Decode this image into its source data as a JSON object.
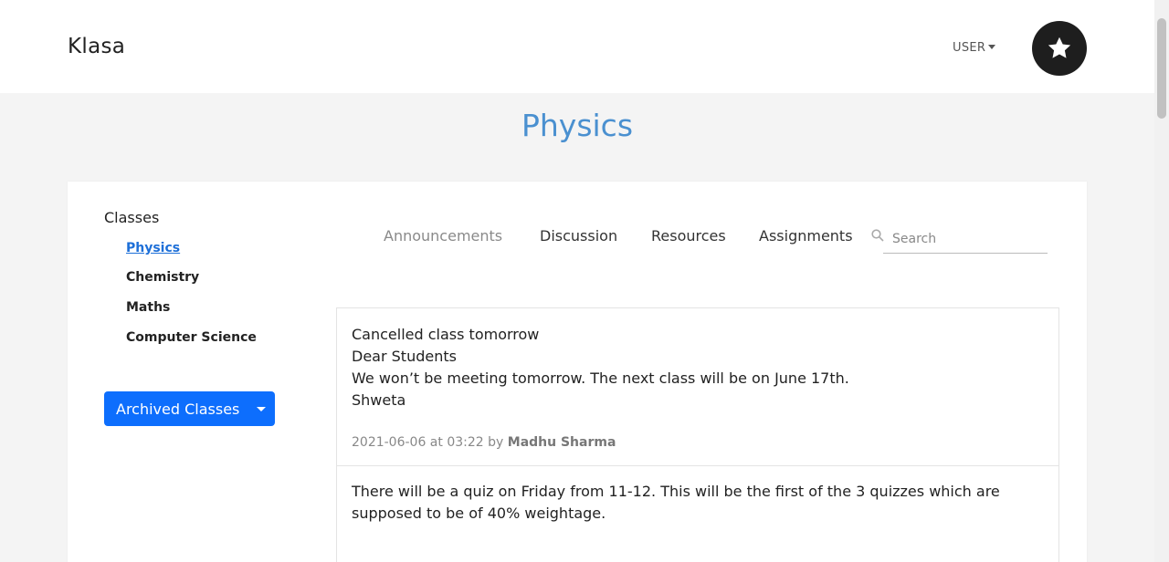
{
  "navbar": {
    "brand": "Klasa",
    "user_label": "USER",
    "avatar_icon": "star-icon"
  },
  "page": {
    "title": "Physics"
  },
  "sidebar": {
    "heading": "Classes",
    "classes": [
      {
        "label": "Physics",
        "active": true
      },
      {
        "label": "Chemistry",
        "active": false
      },
      {
        "label": "Maths",
        "active": false
      },
      {
        "label": "Computer Science",
        "active": false
      }
    ],
    "archived_label": "Archived Classes"
  },
  "tabs": [
    {
      "label": "Announcements",
      "active": true
    },
    {
      "label": "Discussion",
      "active": false
    },
    {
      "label": "Resources",
      "active": false
    },
    {
      "label": "Assignments",
      "active": false
    }
  ],
  "search": {
    "placeholder": "Search",
    "value": ""
  },
  "posts": [
    {
      "lines": [
        "Cancelled class tomorrow",
        "Dear Students",
        "We won’t be meeting tomorrow. The next class will be on June 17th.",
        "Shweta"
      ],
      "timestamp": "2021-06-06 at 03:22",
      "by": "by",
      "author": "Madhu Sharma"
    },
    {
      "lines": [
        "There will be a quiz on Friday from 11-12. This will be the first of the 3 quizzes which are",
        "supposed to be of 40% weightage."
      ]
    }
  ],
  "colors": {
    "accent": "#4a90d0",
    "primary_button": "#0d6efd",
    "active_class_link": "#1d6fd8"
  }
}
